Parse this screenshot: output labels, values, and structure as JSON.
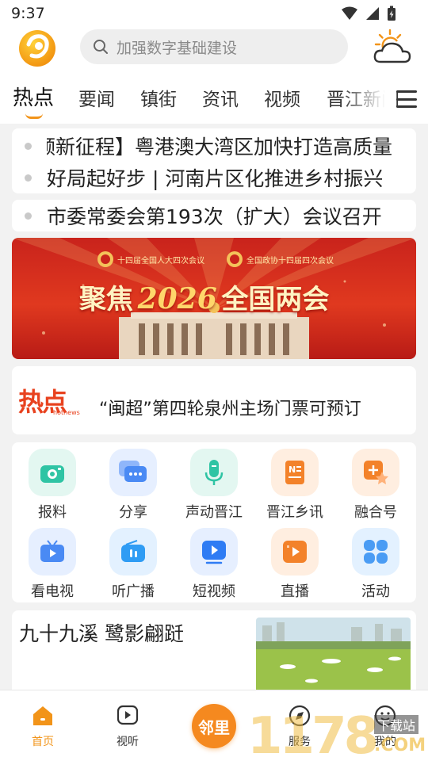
{
  "status_bar": {
    "time": "9:37"
  },
  "search": {
    "placeholder": "加强数字基础建设"
  },
  "tabs": [
    {
      "label": "热点",
      "active": true
    },
    {
      "label": "要闻"
    },
    {
      "label": "镇街"
    },
    {
      "label": "资讯"
    },
    {
      "label": "视频"
    },
    {
      "label": "晋江新闻"
    }
  ],
  "ticker": [
    "领新征程】粤港澳大湾区加快打造高质量",
    "好局起好步 | 河南片区化推进乡村振兴",
    "市委常委会第193次（扩大）会议召开"
  ],
  "banner": {
    "left_emblem_text": "十四届全国人大四次会议",
    "right_emblem_text": "全国政协十四届四次会议",
    "title_part1": "聚焦",
    "title_year": "2026",
    "title_part2": "全国两会"
  },
  "hot_news": {
    "brand_cn": "热点",
    "brand_en": "hotnews",
    "headline": "“闽超”第四轮泉州主场门票可预订"
  },
  "services": [
    {
      "label": "报料",
      "icon": "camera-icon",
      "color": "#2fc4a4"
    },
    {
      "label": "分享",
      "icon": "chat-bubble-icon",
      "color": "#4a8af4"
    },
    {
      "label": "声动晋江",
      "icon": "microphone-icon",
      "color": "#2fc4a4"
    },
    {
      "label": "晋江乡讯",
      "icon": "newspaper-icon",
      "color": "#f3822a"
    },
    {
      "label": "融合号",
      "icon": "star-plus-icon",
      "color": "#f3822a"
    },
    {
      "label": "看电视",
      "icon": "tv-icon",
      "color": "#4a8af4"
    },
    {
      "label": "听广播",
      "icon": "radio-icon",
      "color": "#2f9cf4"
    },
    {
      "label": "短视频",
      "icon": "video-play-icon",
      "color": "#2f7cf4"
    },
    {
      "label": "直播",
      "icon": "live-icon",
      "color": "#f3822a"
    },
    {
      "label": "活动",
      "icon": "grid-icon",
      "color": "#4a9cf4"
    }
  ],
  "article": {
    "title": "九十九溪 鹭影翩跹"
  },
  "bottom_nav": [
    {
      "label": "首页",
      "active": true
    },
    {
      "label": "视听"
    },
    {
      "label": "邻里",
      "center": true
    },
    {
      "label": "服务"
    },
    {
      "label": "我的"
    }
  ],
  "watermark": {
    "number": "1178",
    "site": "下载站",
    "suffix": ".COM"
  },
  "colors": {
    "accent": "#f29419",
    "banner_red": "#d42b1e"
  }
}
